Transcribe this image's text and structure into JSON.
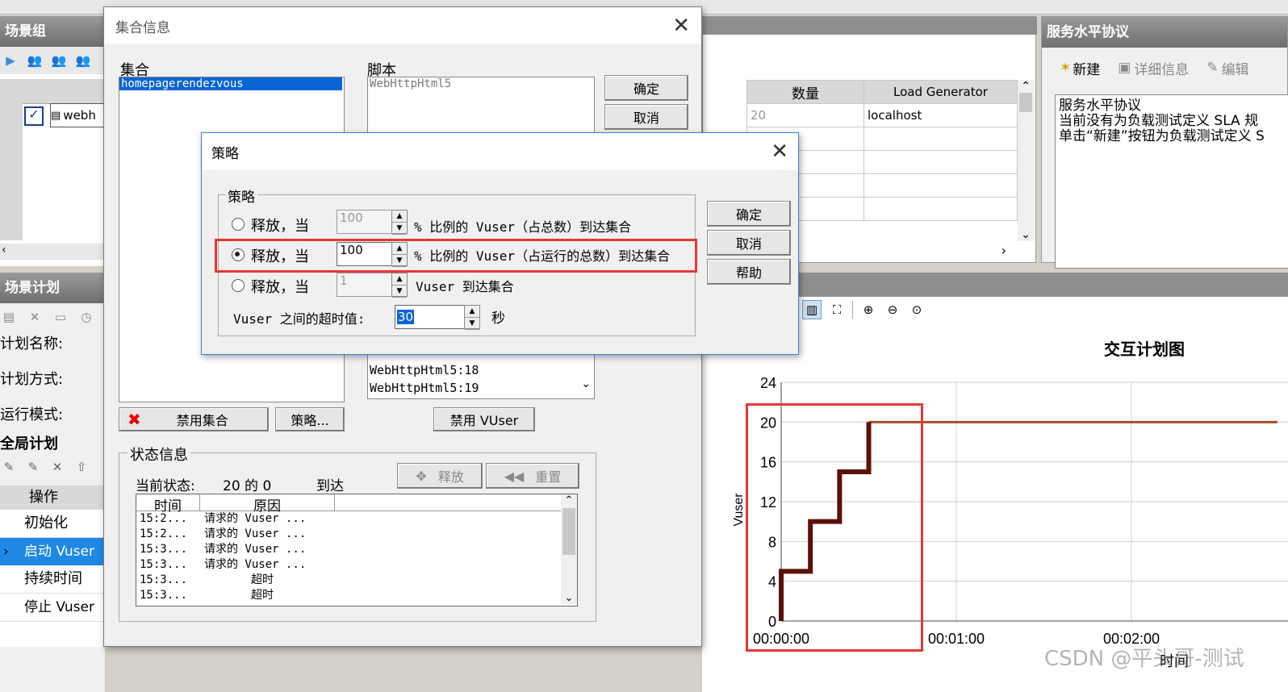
{
  "scenario_group": {
    "title": "场景组",
    "row_text": "webh"
  },
  "sla": {
    "title": "服务水平协议",
    "toolbar": {
      "new": "新建",
      "details": "详细信息",
      "edit": "编辑"
    },
    "lines": [
      "服务水平协议",
      "当前没有为负载测试定义 SLA 规",
      "单击“新建”按钮为负载测试定义 S"
    ]
  },
  "group_table": {
    "col_qty": "数量",
    "col_lg": "Load Generator",
    "qty": "20",
    "lg": "localhost"
  },
  "schedule": {
    "title": "场景计划",
    "name_label": "计划名称:",
    "method_label": "计划方式:",
    "mode_label": "运行模式:",
    "global_title": "全局计划",
    "op_header": "操作",
    "ops": [
      "初始化",
      "启动 Vuser",
      "持续时间",
      "停止 Vuser"
    ]
  },
  "rendezvous": {
    "title": "集合信息",
    "rv_label": "集合",
    "rv_item": "homepagerendezvous",
    "script_label": "脚本",
    "script_item": "WebHttpHtml5",
    "ok": "确定",
    "cancel": "取消",
    "vuser_items": [
      "WebHttpHtml5:18",
      "WebHttpHtml5:19"
    ],
    "disable_rv": "禁用集合",
    "policy_btn": "策略...",
    "disable_vuser": "禁用 VUser",
    "status_group": "状态信息",
    "current_status_label": "当前状态:",
    "current_status_value": "20 的 0",
    "arrived": "到达",
    "release_btn": "释放",
    "reset_btn": "重置",
    "log_cols": [
      "时间",
      "原因"
    ],
    "log_rows": [
      [
        "15:2...",
        "请求的 Vuser ..."
      ],
      [
        "15:2...",
        "请求的 Vuser ..."
      ],
      [
        "15:3...",
        "请求的 Vuser ..."
      ],
      [
        "15:3...",
        "请求的 Vuser ..."
      ],
      [
        "15:3...",
        "超时"
      ],
      [
        "15:3...",
        "超时"
      ]
    ]
  },
  "policy": {
    "title": "策略",
    "group": "策略",
    "opt1_label": "释放，当",
    "opt1_value": "100",
    "opt1_text": "% 比例的 Vuser（占总数）到达集合",
    "opt2_label": "释放，当",
    "opt2_value": "100",
    "opt2_text": "% 比例的 Vuser（占运行的总数）到达集合",
    "opt3_label": "释放，当",
    "opt3_value": "1",
    "opt3_text": "Vuser 到达集合",
    "timeout_label": "Vuser 之间的超时值:",
    "timeout_value": "30",
    "timeout_unit": "秒",
    "ok": "确定",
    "cancel": "取消",
    "help": "帮助"
  },
  "chart_data": {
    "type": "line",
    "title": "交互计划图",
    "xlabel": "时间",
    "ylabel": "Vuser",
    "yticks": [
      0,
      4,
      8,
      12,
      16,
      20,
      24
    ],
    "xticks": [
      "00:00:00",
      "00:01:00",
      "00:02:00"
    ],
    "xlim_seconds": [
      0,
      170
    ],
    "ylim": [
      0,
      24
    ],
    "series": [
      {
        "x": [
          0,
          0,
          10,
          10,
          20,
          20,
          30,
          30,
          170
        ],
        "y": [
          0,
          5,
          5,
          10,
          10,
          15,
          15,
          20,
          20
        ]
      }
    ],
    "colors": {
      "rampup": "#5a1208",
      "hold": "#a0522d"
    }
  },
  "watermark": "CSDN @平头哥-测试"
}
